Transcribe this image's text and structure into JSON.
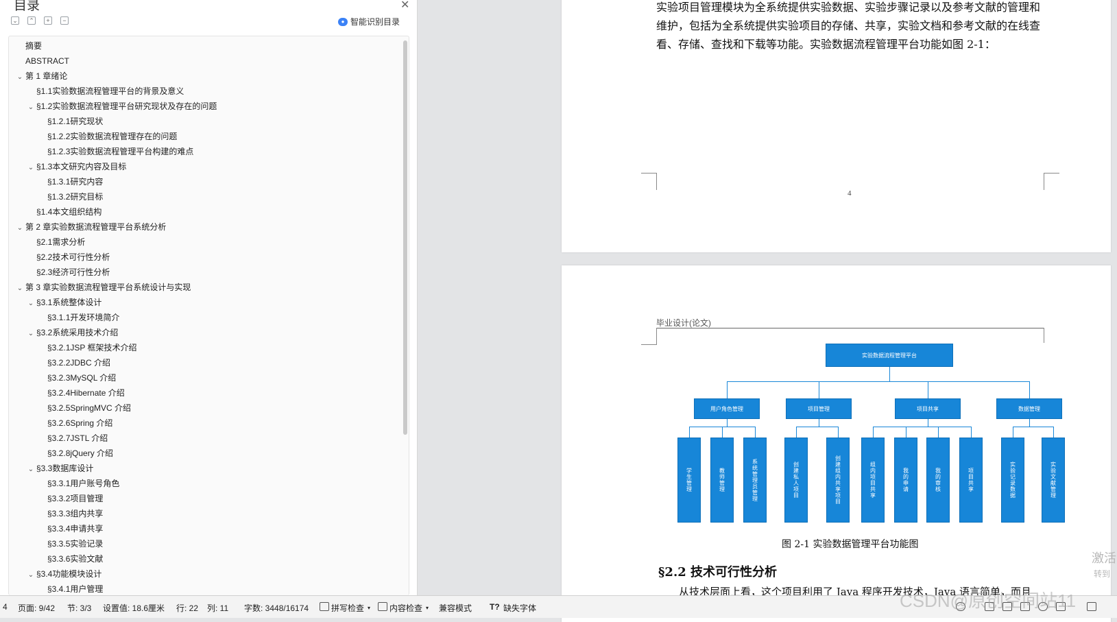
{
  "toc": {
    "title": "目录",
    "close_glyph": "✕",
    "tool_icons": [
      "expand-all-icon",
      "collapse-all-icon",
      "add-level-icon",
      "remove-level-icon"
    ],
    "smart_label": "智能识别目录",
    "items": [
      {
        "label": "摘要",
        "level": 0,
        "expandable": false
      },
      {
        "label": "ABSTRACT",
        "level": 0,
        "expandable": false
      },
      {
        "label": "第 1 章绪论",
        "level": 0,
        "expandable": true
      },
      {
        "label": "§1.1实验数据流程管理平台的背景及意义",
        "level": 1,
        "expandable": false
      },
      {
        "label": "§1.2实验数据流程管理平台研究现状及存在的问题",
        "level": 1,
        "expandable": true
      },
      {
        "label": "§1.2.1研究现状",
        "level": 2,
        "expandable": false
      },
      {
        "label": "§1.2.2实验数据流程管理存在的问题",
        "level": 2,
        "expandable": false
      },
      {
        "label": "§1.2.3实验数据流程管理平台构建的难点",
        "level": 2,
        "expandable": false
      },
      {
        "label": "§1.3本文研究内容及目标",
        "level": 1,
        "expandable": true
      },
      {
        "label": "§1.3.1研究内容",
        "level": 2,
        "expandable": false
      },
      {
        "label": "§1.3.2研究目标",
        "level": 2,
        "expandable": false
      },
      {
        "label": "§1.4本文组织结构",
        "level": 1,
        "expandable": false
      },
      {
        "label": "第 2 章实验数据流程管理平台系统分析",
        "level": 0,
        "expandable": true
      },
      {
        "label": "§2.1需求分析",
        "level": 1,
        "expandable": false
      },
      {
        "label": "§2.2技术可行性分析",
        "level": 1,
        "expandable": false
      },
      {
        "label": "§2.3经济可行性分析",
        "level": 1,
        "expandable": false
      },
      {
        "label": "第 3 章实验数据流程管理平台系统设计与实现",
        "level": 0,
        "expandable": true
      },
      {
        "label": "§3.1系统整体设计",
        "level": 1,
        "expandable": true
      },
      {
        "label": "§3.1.1开发环境简介",
        "level": 2,
        "expandable": false
      },
      {
        "label": "§3.2系统采用技术介绍",
        "level": 1,
        "expandable": true
      },
      {
        "label": "§3.2.1JSP 框架技术介绍",
        "level": 2,
        "expandable": false
      },
      {
        "label": "§3.2.2JDBC 介绍",
        "level": 2,
        "expandable": false
      },
      {
        "label": "§3.2.3MySQL 介绍",
        "level": 2,
        "expandable": false
      },
      {
        "label": "§3.2.4Hibernate 介绍",
        "level": 2,
        "expandable": false
      },
      {
        "label": "§3.2.5SpringMVC 介绍",
        "level": 2,
        "expandable": false
      },
      {
        "label": "§3.2.6Spring 介绍",
        "level": 2,
        "expandable": false
      },
      {
        "label": "§3.2.7JSTL 介绍",
        "level": 2,
        "expandable": false
      },
      {
        "label": "§3.2.8jQuery 介绍",
        "level": 2,
        "expandable": false
      },
      {
        "label": "§3.3数据库设计",
        "level": 1,
        "expandable": true
      },
      {
        "label": "§3.3.1用户账号角色",
        "level": 2,
        "expandable": false
      },
      {
        "label": "§3.3.2项目管理",
        "level": 2,
        "expandable": false
      },
      {
        "label": "§3.3.3组内共享",
        "level": 2,
        "expandable": false
      },
      {
        "label": "§3.3.4申请共享",
        "level": 2,
        "expandable": false
      },
      {
        "label": "§3.3.5实验记录",
        "level": 2,
        "expandable": false
      },
      {
        "label": "§3.3.6实验文献",
        "level": 2,
        "expandable": false
      },
      {
        "label": "§3.4功能模块设计",
        "level": 1,
        "expandable": true
      },
      {
        "label": "§3.4.1用户管理",
        "level": 2,
        "expandable": false
      }
    ]
  },
  "document": {
    "page_a_lines": [
      "实验项目管理模块为全系统提供实验数据、实验步骤记录以及参考文献的管理和",
      "维护，包括为全系统提供实验项目的存储、共享，实验文档和参考文献的在线查",
      "看、存储、查找和下载等功能。实验数据流程管理平台功能如图 2-1："
    ],
    "page_number": "4",
    "header_text": "毕业设计(论文)",
    "figure": {
      "root": "实验数据流程管理平台",
      "groups": [
        {
          "name": "用户角色管理",
          "children": [
            "学生管理",
            "教师管理",
            "系统管理员管理"
          ]
        },
        {
          "name": "项目管理",
          "children": [
            "创建私人项目",
            "创建组内共享项目"
          ]
        },
        {
          "name": "项目共享",
          "children": [
            "组内项目共享",
            "我的申请",
            "我的审核",
            "项目共享"
          ]
        },
        {
          "name": "数据管理",
          "children": [
            "实验记录数据",
            "实验文献管理"
          ]
        }
      ],
      "caption": "图 2-1  实验数据管理平台功能图"
    },
    "section_heading": "§2.2  技术可行性分析",
    "section_body": "从技术层面上看，这个项目利用了 Java 程序开发技术，Java 语言简单，而且",
    "overlay_main": "激活",
    "overlay_sub": "转到"
  },
  "status_bar": {
    "page_index": "4",
    "page": "页面: 9/42",
    "section": "节: 3/3",
    "setting": "设置值: 18.6厘米",
    "row": "行: 22",
    "col": "列: 11",
    "words": "字数: 3448/16174",
    "spell_check": "拼写检查",
    "content_check": "内容检查",
    "compat_mode": "兼容模式",
    "missing_font": "缺失字体",
    "watermark": "CSDN@原创空间站11"
  }
}
